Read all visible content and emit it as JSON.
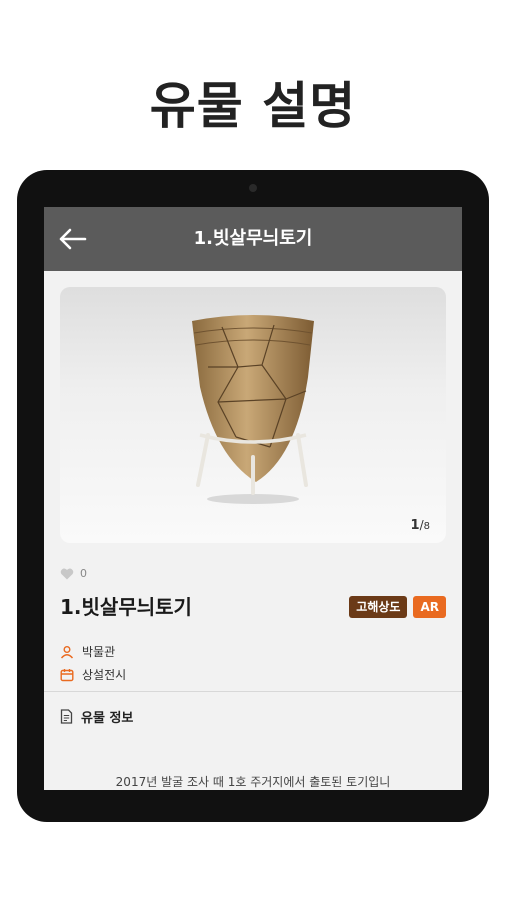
{
  "promo": {
    "title": "유물 설명"
  },
  "appbar": {
    "title": "1.빗살무늬토기"
  },
  "image_viewer": {
    "current_page": "1",
    "separator": "/",
    "total_pages": "8"
  },
  "likes": {
    "count": "0"
  },
  "artifact": {
    "name": "1.빗살무늬토기",
    "tags": [
      {
        "label": "고해상도",
        "color": "#6b3a17"
      },
      {
        "label": "AR",
        "color": "#e96a20"
      }
    ],
    "museum": "박물관",
    "exhibit": "상설전시"
  },
  "info_section": {
    "title": "유물 정보",
    "description": "2017년 발굴 조사 때 1호 주거지에서 출토된 토기입니"
  },
  "icons": [
    "back-arrow-icon",
    "heart-icon",
    "person-icon",
    "calendar-icon",
    "document-icon"
  ]
}
